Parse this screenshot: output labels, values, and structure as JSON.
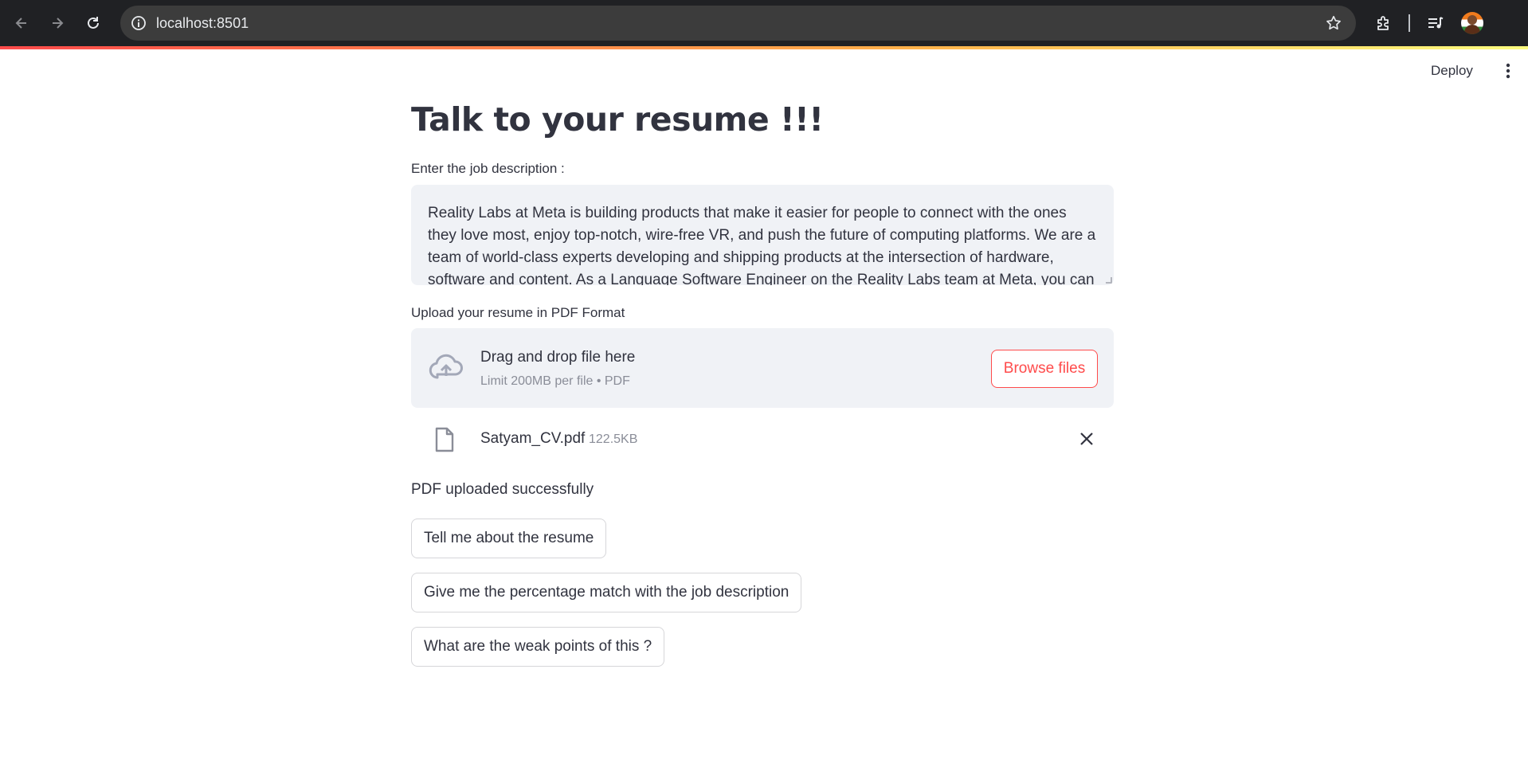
{
  "browser": {
    "url": "localhost:8501"
  },
  "app_header": {
    "deploy_label": "Deploy"
  },
  "main": {
    "title": "Talk to your resume !!!",
    "job_description": {
      "label": "Enter the job description :",
      "value": "Reality Labs at Meta is building products that make it easier for people to connect with the ones they love most, enjoy top-notch, wire-free VR, and push the future of computing platforms. We are a team of world-class experts developing and shipping products at the intersection of hardware, software and content. As a Language Software Engineer on the Reality Labs team at Meta, you can"
    },
    "uploader": {
      "label": "Upload your resume in PDF Format",
      "drop_title": "Drag and drop file here",
      "drop_subtitle": "Limit 200MB per file • PDF",
      "browse_label": "Browse files"
    },
    "uploaded_file": {
      "name": "Satyam_CV.pdf",
      "size": "122.5KB"
    },
    "status": "PDF uploaded successfully",
    "actions": [
      {
        "label": "Tell me about the resume"
      },
      {
        "label": "Give me the percentage match with the job description"
      },
      {
        "label": "What are the weak points of this ?"
      }
    ]
  },
  "colors": {
    "primary": "#ff4b4b",
    "text": "#31333f",
    "muted": "#8a8d98",
    "panel": "#f0f2f6"
  }
}
